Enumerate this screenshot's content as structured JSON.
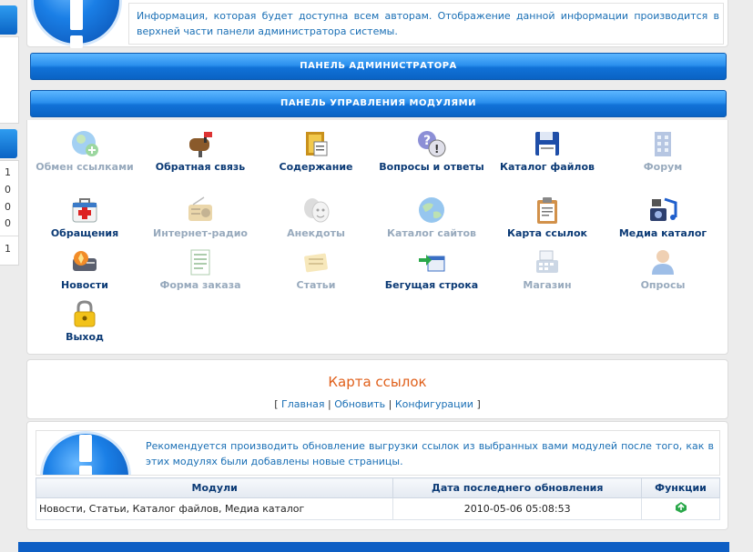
{
  "sidebar": {
    "numbers": [
      "1",
      "0",
      "0",
      "0",
      "1"
    ]
  },
  "top_info": {
    "text": "Информация, которая будет доступна всем авторам. Отображение данной информации производится в верхней части панели администратора системы."
  },
  "bars": {
    "admin": "ПАНЕЛЬ АДМИНИСТРАТОРА",
    "modules": "ПАНЕЛЬ УПРАВЛЕНИЯ МОДУЛЯМИ"
  },
  "modules": [
    {
      "label": "Обмен ссылками",
      "icon": "globe-add-icon",
      "enabled": false
    },
    {
      "label": "Обратная связь",
      "icon": "mailbox-icon",
      "enabled": true
    },
    {
      "label": "Содержание",
      "icon": "book-icon",
      "enabled": true
    },
    {
      "label": "Вопросы и ответы",
      "icon": "question-icon",
      "enabled": true
    },
    {
      "label": "Каталог файлов",
      "icon": "floppy-icon",
      "enabled": true
    },
    {
      "label": "Форум",
      "icon": "building-icon",
      "enabled": false
    },
    {
      "label": "Обращения",
      "icon": "first-aid-icon",
      "enabled": true
    },
    {
      "label": "Интернет-радио",
      "icon": "radio-icon",
      "enabled": false
    },
    {
      "label": "Анекдоты",
      "icon": "masks-icon",
      "enabled": false
    },
    {
      "label": "Каталог сайтов",
      "icon": "globe-icon",
      "enabled": false
    },
    {
      "label": "Карта ссылок",
      "icon": "clipboard-icon",
      "enabled": true
    },
    {
      "label": "Медиа каталог",
      "icon": "media-icon",
      "enabled": true
    },
    {
      "label": "Новости",
      "icon": "news-icon",
      "enabled": true
    },
    {
      "label": "Форма заказа",
      "icon": "form-icon",
      "enabled": false
    },
    {
      "label": "Статьи",
      "icon": "articles-icon",
      "enabled": false
    },
    {
      "label": "Бегущая строка",
      "icon": "ticker-icon",
      "enabled": true
    },
    {
      "label": "Магазин",
      "icon": "cash-register-icon",
      "enabled": false
    },
    {
      "label": "Опросы",
      "icon": "user-icon",
      "enabled": false
    },
    {
      "label": "Выход",
      "icon": "lock-icon",
      "enabled": true
    }
  ],
  "sitemap": {
    "title": "Карта ссылок",
    "bracket_open": "[",
    "bracket_close": "]",
    "separator": "|",
    "links": {
      "main": "Главная",
      "refresh": "Обновить",
      "config": "Конфигурации"
    },
    "info": "Рекомендуется производить обновление выгрузки ссылок из выбранных вами модулей после того, как в этих модулях были добавлены новые страницы.",
    "table": {
      "headers": {
        "modules": "Модули",
        "date": "Дата последнего обновления",
        "functions": "Функции"
      },
      "row": {
        "modules": "Новости, Статьи, Каталог файлов, Медиа каталог",
        "date": "2010-05-06 05:08:53"
      }
    }
  },
  "colors": {
    "accent_blue": "#0a63c4",
    "title_orange": "#e0601b",
    "link_blue": "#1a6fb5"
  }
}
